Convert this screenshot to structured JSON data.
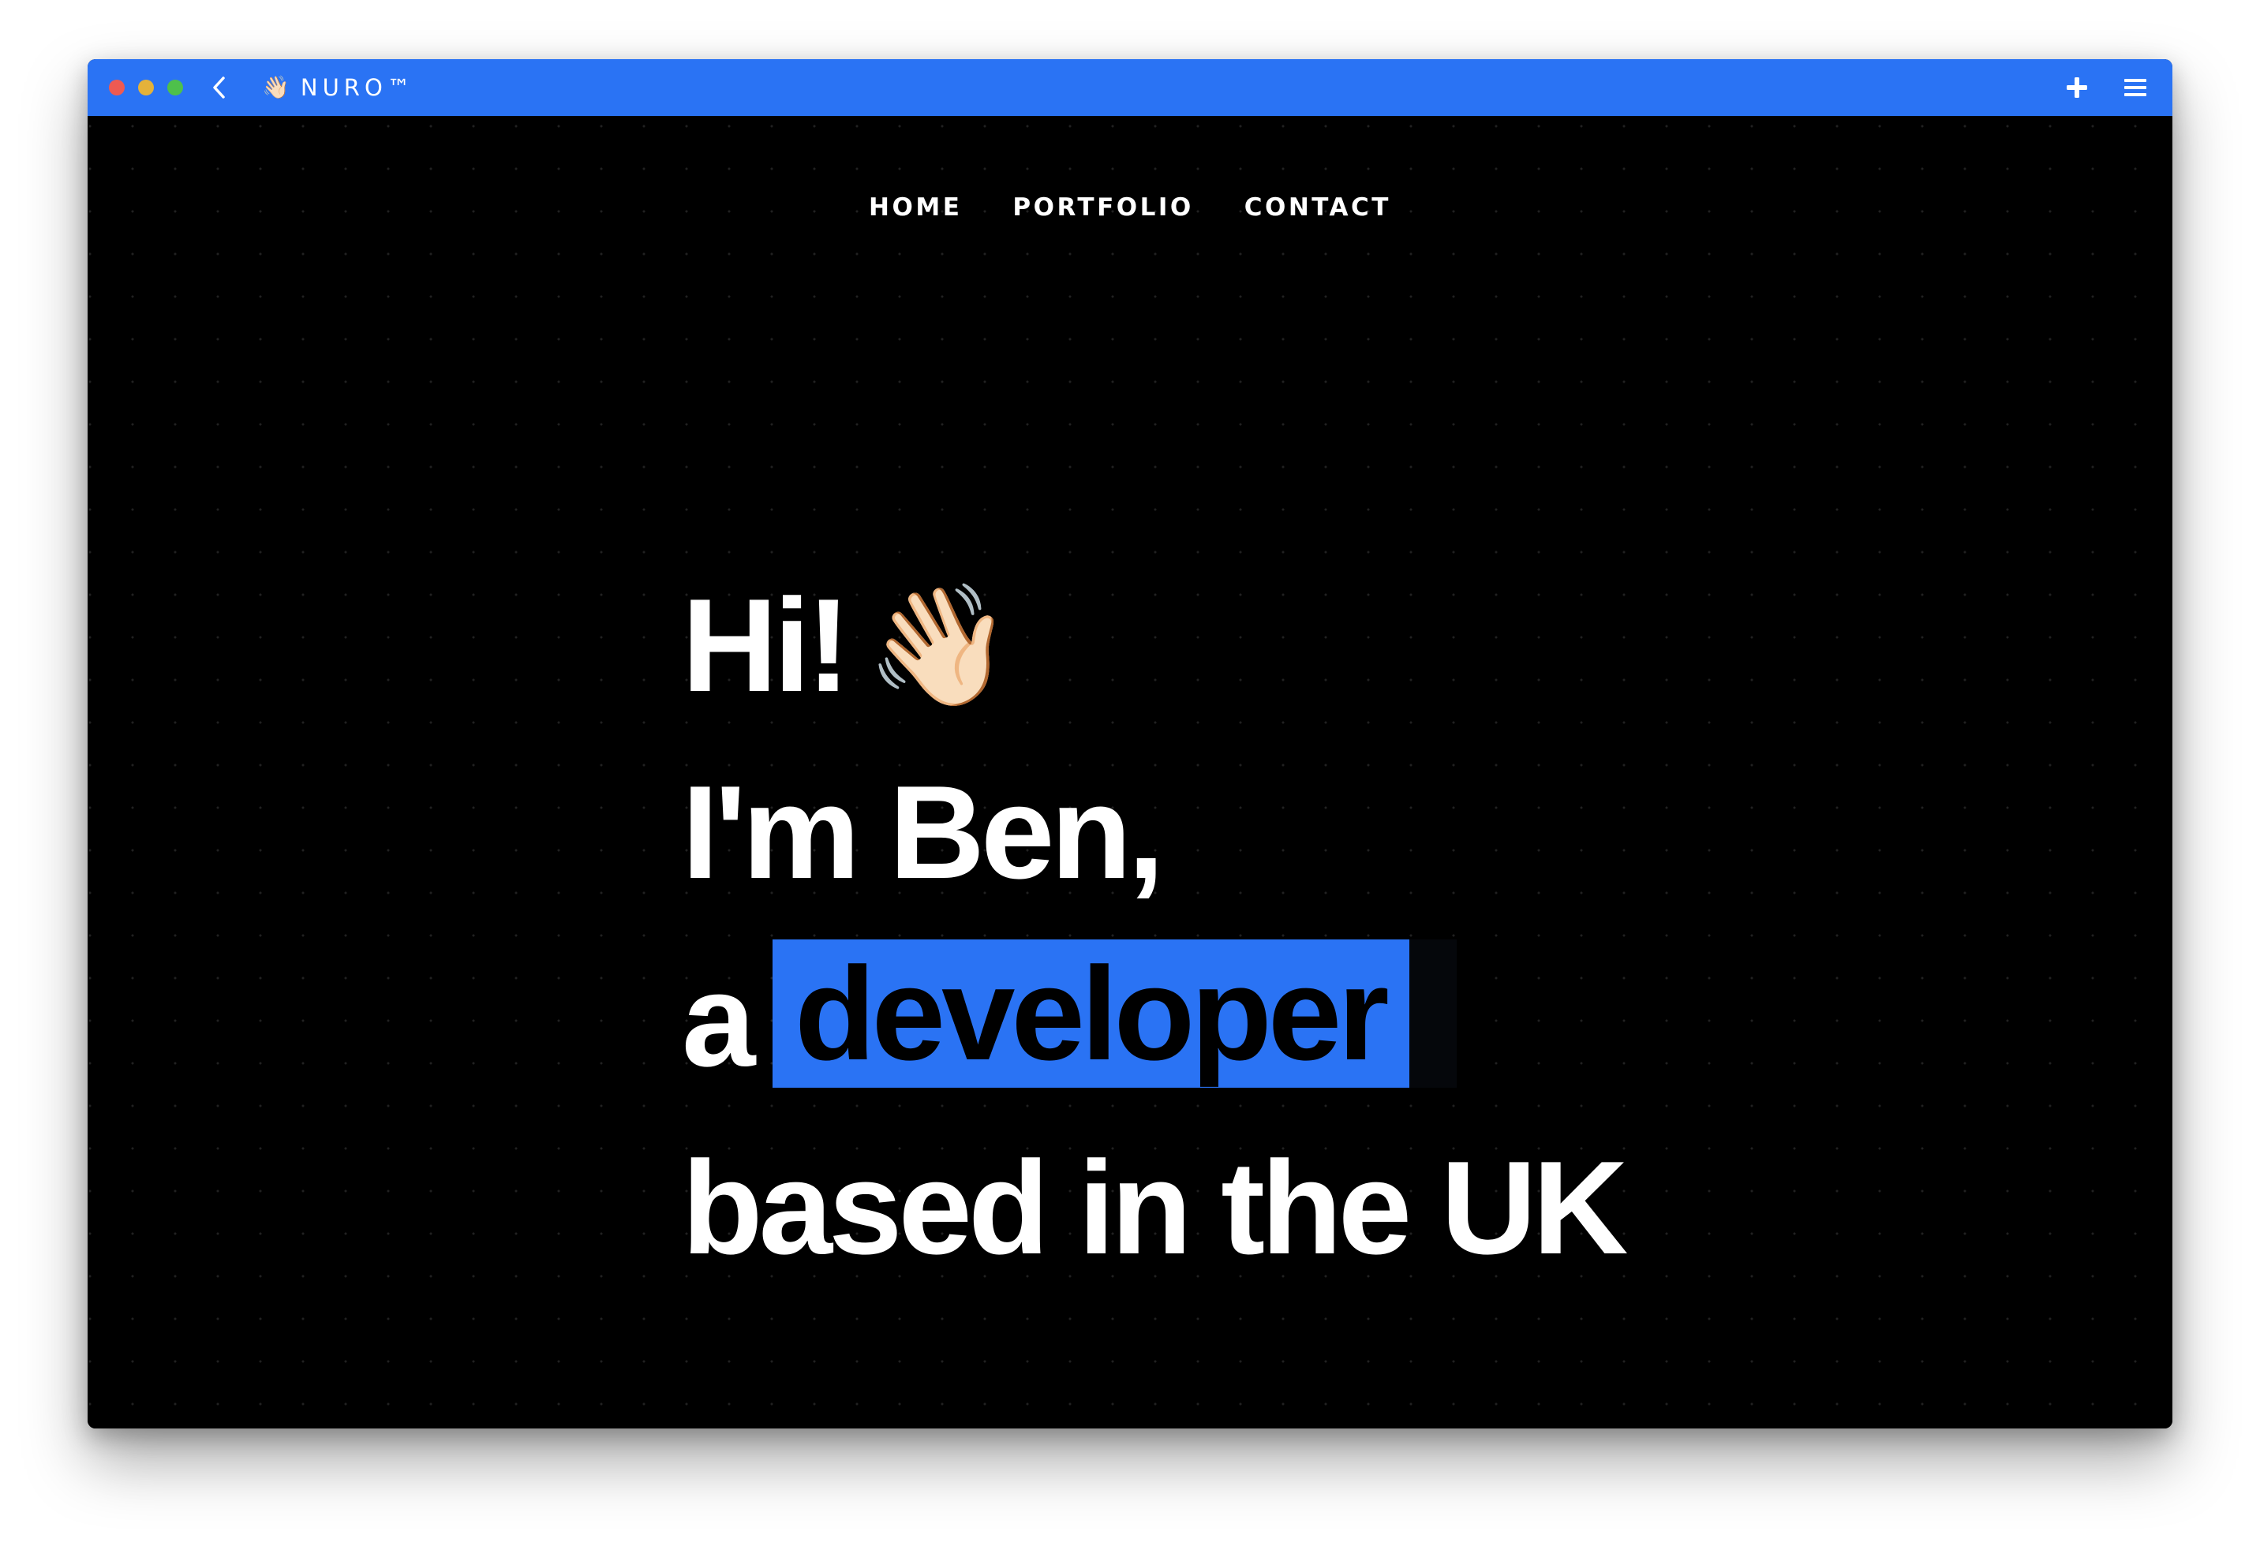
{
  "window": {
    "brand_emoji": "👋🏻",
    "brand_name": "NURO™",
    "accent_color": "#2a73f4",
    "icons": {
      "back": "chevron-left-icon",
      "add": "plus-icon",
      "menu": "hamburger-menu-icon"
    }
  },
  "nav": {
    "items": [
      {
        "label": "HOME"
      },
      {
        "label": "PORTFOLIO"
      },
      {
        "label": "CONTACT"
      }
    ]
  },
  "hero": {
    "line1_text": "Hi!",
    "line1_emoji": "👋🏻",
    "line2_text": "I'm Ben,",
    "line3_prefix": "a",
    "line3_highlight": "developer",
    "line4_text": "based in the UK"
  }
}
